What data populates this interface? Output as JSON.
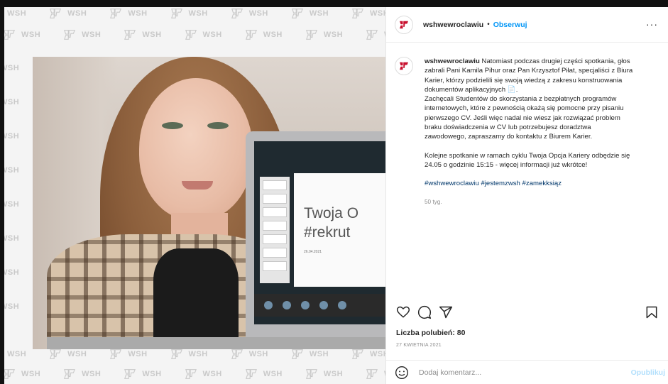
{
  "watermark": {
    "text": "WSH"
  },
  "slide": {
    "line1": "Twoja O",
    "line2": "#rekrut",
    "date": "26.04.2021"
  },
  "header": {
    "username": "wshwewroclawiu",
    "separator": "•",
    "follow_label": "Obserwuj",
    "more_label": "···"
  },
  "post": {
    "username": "wshwewroclawiu",
    "caption_lines": [
      "Natomiast podczas drugiej części spotkania, głos",
      "zabrali Pani Kamila Pihur oraz Pan Krzysztof Piłat, specjaliści z Biura",
      "Karier, którzy podzielili się swoją wiedzą z zakresu konstruowania",
      "dokumentów aplikacyjnych 📄.",
      "Zachęcali Studentów do skorzystania z bezpłatnych programów",
      "internetowych, które z pewnością okażą się pomocne przy pisaniu",
      "pierwszego CV. Jeśli więc nadal nie wiesz jak rozwiązać problem",
      "braku doświadczenia w CV lub potrzebujesz doradztwa",
      "zawodowego, zapraszamy do kontaktu z Biurem Karier."
    ],
    "caption_lines_2": [
      "Kolejne spotkanie w ramach cyklu Twoja Opcja Kariery odbędzie się",
      "24.05 o godzinie 15:15 - więcej informacji już wkrótce!"
    ],
    "hashtags": "#wshwewroclawiu #jestemzwsh #zamekksiąz",
    "time_ago": "50 tyg."
  },
  "actions": {
    "icons": [
      "heart-icon",
      "comment-icon",
      "share-icon",
      "bookmark-icon"
    ]
  },
  "likes_text": "Liczba polubień: 80",
  "date_text": "27 KWIETNIA 2021",
  "comment_box": {
    "placeholder": "Dodaj komentarz...",
    "publish_label": "Opublikuj"
  },
  "colors": {
    "link_blue": "#0095f6",
    "publish_disabled": "#b2dffc",
    "hashtag": "#00376b",
    "muted": "#8e8e8e"
  }
}
